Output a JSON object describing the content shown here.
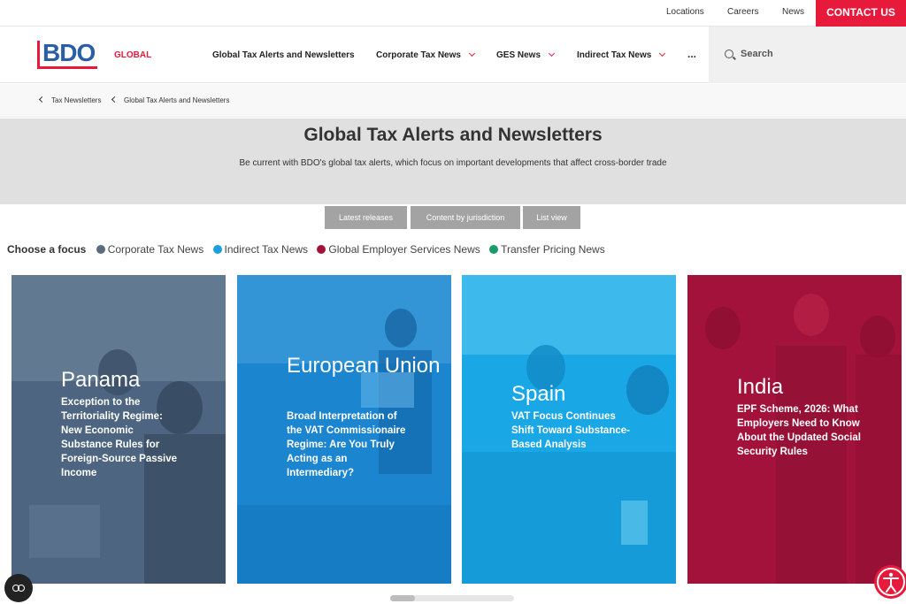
{
  "topbar": {
    "links": [
      "Locations",
      "Careers",
      "News"
    ],
    "contact": "CONTACT US"
  },
  "header": {
    "logo": "BDO",
    "region": "GLOBAL",
    "nav": [
      {
        "label": "Global Tax Alerts and Newsletters",
        "dropdown": false
      },
      {
        "label": "Corporate Tax News",
        "dropdown": true
      },
      {
        "label": "GES News",
        "dropdown": true
      },
      {
        "label": "Indirect Tax News",
        "dropdown": true
      }
    ],
    "more": "...",
    "search": "Search"
  },
  "breadcrumb": [
    "Tax Newsletters",
    "Global Tax Alerts and Newsletters"
  ],
  "hero": {
    "title": "Global Tax Alerts and Newsletters",
    "subtitle": "Be current with BDO's global tax alerts, which focus on important developments that affect cross-border trade"
  },
  "view_buttons": [
    "Latest releases",
    "Content by jurisdiction",
    "List view"
  ],
  "focus": {
    "label": "Choose a focus",
    "items": [
      {
        "label": "Corporate Tax News",
        "color": "#5a6b80"
      },
      {
        "label": "Indirect Tax News",
        "color": "#1a9fe0"
      },
      {
        "label": "Global Employer Services News",
        "color": "#a3123a"
      },
      {
        "label": "Transfer Pricing News",
        "color": "#1a9a68"
      }
    ]
  },
  "cards": [
    {
      "country": "Panama",
      "title": "Exception to the Territoriality Regime: New Economic Substance Rules for Foreign-Source Passive Income",
      "color": "#4d6580"
    },
    {
      "country": "European Union",
      "title": "Broad Interpretation of the VAT Commissionaire Regime: Are You Truly Acting as an Intermediary?",
      "color": "#1b85d0"
    },
    {
      "country": "Spain",
      "title": "VAT Focus Continues Shift Toward Substance-Based Analysis",
      "color": "#1aa7e5"
    },
    {
      "country": "India",
      "title": "EPF Scheme, 2026: What Employers Need to Know About the Updated Social Security Rules",
      "color": "#a3123a"
    }
  ],
  "colors": {
    "accent": "#e81a3b",
    "brand_blue": "#2a5ea7"
  }
}
